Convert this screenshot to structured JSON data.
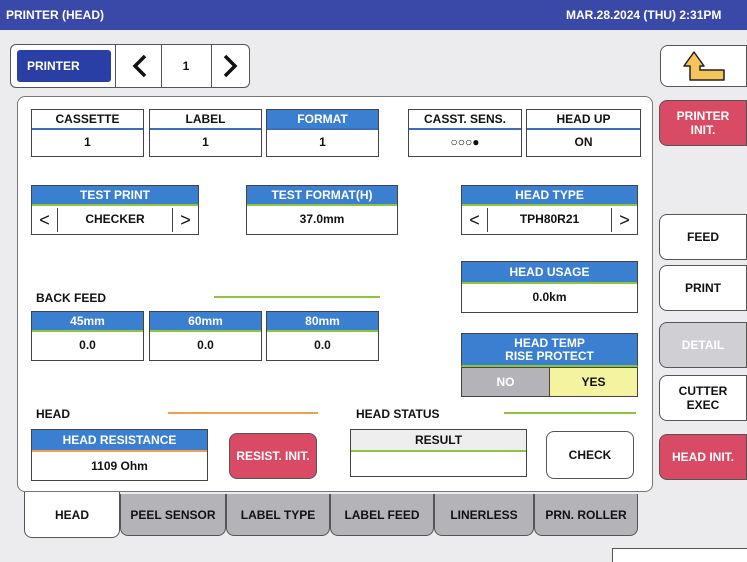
{
  "title": "PRINTER (HEAD)",
  "datetime": "MAR.28.2024 (THU)  2:31PM",
  "nav": {
    "label": "PRINTER",
    "page": "1",
    "prev_icon": "chevron-left-icon",
    "next_icon": "chevron-right-icon"
  },
  "back_icon": "return-arrow-icon",
  "status": {
    "cassette": {
      "label": "CASSETTE",
      "value": "1"
    },
    "label": {
      "label": "LABEL",
      "value": "1"
    },
    "format": {
      "label": "FORMAT",
      "value": "1"
    },
    "casst_sens": {
      "label": "CASST. SENS.",
      "value": "○○○●"
    },
    "head_up": {
      "label": "HEAD UP",
      "value": "ON"
    }
  },
  "test_print": {
    "label": "TEST PRINT",
    "value": "CHECKER"
  },
  "test_format": {
    "label": "TEST FORMAT(H)",
    "value": "37.0mm"
  },
  "head_type": {
    "label": "HEAD TYPE",
    "value": "TPH80R21"
  },
  "head_usage": {
    "label": "HEAD USAGE",
    "value": "0.0km"
  },
  "back_feed": {
    "label": "BACK FEED",
    "items": [
      {
        "label": "45mm",
        "value": "0.0"
      },
      {
        "label": "60mm",
        "value": "0.0"
      },
      {
        "label": "80mm",
        "value": "0.0"
      }
    ]
  },
  "head_temp": {
    "label_line1": "HEAD TEMP",
    "label_line2": "RISE PROTECT",
    "options": [
      "NO",
      "YES"
    ],
    "selected": "YES"
  },
  "head": {
    "label": "HEAD",
    "resistance_label": "HEAD RESISTANCE",
    "resistance_value": "1109 Ohm",
    "resist_init": "RESIST. INIT."
  },
  "head_status": {
    "label": "HEAD STATUS",
    "result_label": "RESULT",
    "result_value": "",
    "check": "CHECK"
  },
  "side_buttons": {
    "printer_init": "PRINTER\nINIT.",
    "feed": "FEED",
    "print": "PRINT",
    "detail": "DETAIL",
    "cutter_exec": "CUTTER\nEXEC",
    "head_init": "HEAD INIT."
  },
  "tabs": [
    "HEAD",
    "PEEL SENSOR",
    "LABEL TYPE",
    "LABEL FEED",
    "LINERLESS",
    "PRN. ROLLER"
  ],
  "colors": {
    "titlebar": "#3a48a8",
    "accent_blue": "#3a7fd0",
    "pink": "#d94a64",
    "yellow": "#f4f4a0",
    "green_line": "#8cc63f",
    "orange_line": "#f0a050"
  }
}
